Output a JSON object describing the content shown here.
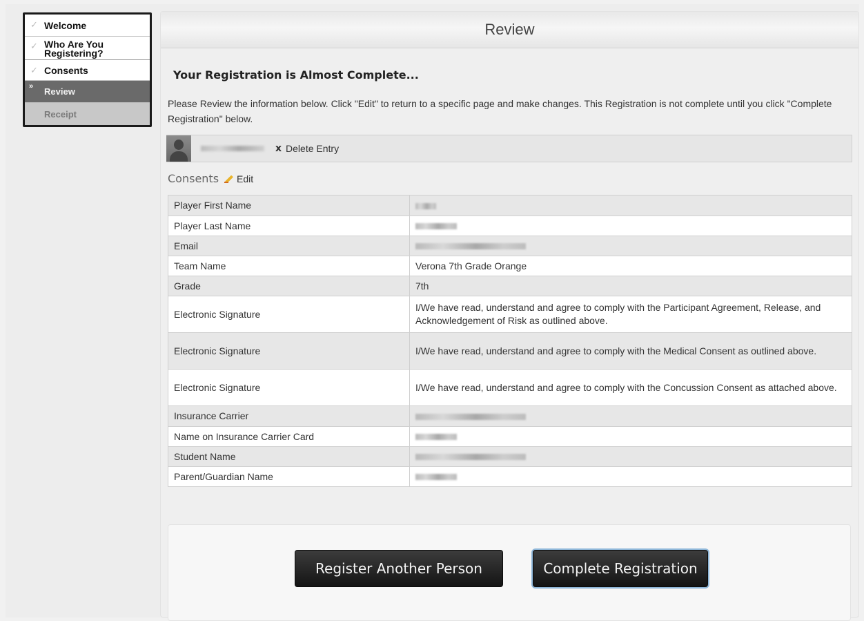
{
  "steps": [
    {
      "label": "Welcome",
      "state": "done"
    },
    {
      "label": "Who Are You Registering?",
      "state": "done"
    },
    {
      "label": "Consents",
      "state": "done"
    },
    {
      "label": "Review",
      "state": "current"
    },
    {
      "label": "Receipt",
      "state": "future"
    }
  ],
  "header": {
    "title": "Review"
  },
  "main": {
    "heading": "Your Registration is Almost Complete...",
    "instructions": "Please Review the information below. Click \"Edit\" to return to a specific page and make changes. This Registration is not complete until you click \"Complete Registration\" below.",
    "entry": {
      "delete_label": "Delete Entry",
      "delete_icon": "x-icon"
    },
    "section": {
      "title": "Consents",
      "edit_label": "Edit",
      "edit_icon": "pencil-icon"
    },
    "rows": [
      {
        "label": "Player First Name",
        "value": ""
      },
      {
        "label": "Player Last Name",
        "value": ""
      },
      {
        "label": "Email",
        "value": ""
      },
      {
        "label": "Team Name",
        "value": "Verona 7th Grade Orange"
      },
      {
        "label": "Grade",
        "value": "7th"
      },
      {
        "label": "Electronic Signature",
        "value": "I/We have read, understand and agree to comply with the Participant Agreement, Release, and Acknowledgement of Risk as outlined above."
      },
      {
        "label": "Electronic Signature",
        "value": "I/We have read, understand and agree to comply with the Medical Consent as outlined above."
      },
      {
        "label": "Electronic Signature",
        "value": "I/We have read, understand and agree to comply with the Concussion Consent as attached above."
      },
      {
        "label": "Insurance Carrier",
        "value": ""
      },
      {
        "label": "Name on Insurance Carrier Card",
        "value": ""
      },
      {
        "label": "Student Name",
        "value": ""
      },
      {
        "label": "Parent/Guardian Name",
        "value": ""
      }
    ]
  },
  "actions": {
    "register_another": "Register Another Person",
    "complete": "Complete Registration"
  },
  "colors": {
    "focus_outline": "#8fb7d9",
    "button_dark": "#141414"
  }
}
